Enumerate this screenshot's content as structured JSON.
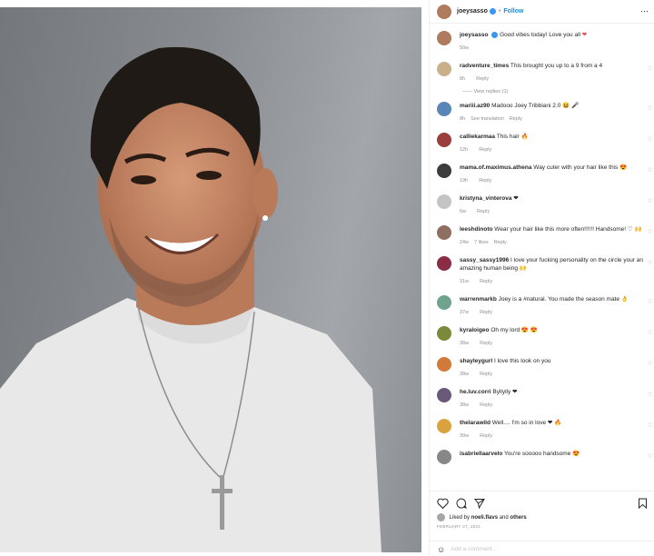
{
  "post": {
    "username": "joeysasso",
    "follow_label": "Follow",
    "caption": "Good vibes today! Love you all",
    "caption_emoji": "❤",
    "caption_time": "50w"
  },
  "comments": [
    {
      "user": "radventure_times",
      "text": "This brought you up to a 9 from a 4",
      "time": "8h",
      "reply": "Reply",
      "extra": "",
      "avatar": "#c9b08a",
      "replies": "View replies (1)"
    },
    {
      "user": "mariii.az90",
      "text": "Madooo Joey Tribbiani 2.0 😆 🎤",
      "time": "8h",
      "reply": "Reply",
      "extra": "See translation",
      "avatar": "#5a86b5",
      "replies": ""
    },
    {
      "user": "calliekarmaa",
      "text": "This hair 🔥",
      "time": "12h",
      "reply": "Reply",
      "extra": "",
      "avatar": "#9b3f3c",
      "replies": ""
    },
    {
      "user": "mama.of.maximus.athena",
      "text": "Way cuter with your hair like this 😍",
      "time": "19h",
      "reply": "Reply",
      "extra": "",
      "avatar": "#3c3c3c",
      "replies": ""
    },
    {
      "user": "kristyna_vinterova",
      "text": "❤",
      "time": "6w",
      "reply": "Reply",
      "extra": "",
      "avatar": "#c4c4c4",
      "replies": ""
    },
    {
      "user": "leeshdinoto",
      "text": "Wear your hair like this more often!!!!!! Handsome! ♡ 🙌",
      "time": "24w",
      "reply": "Reply",
      "extra": "7 likes",
      "avatar": "#8e6f62",
      "replies": ""
    },
    {
      "user": "sassy_sassy1996",
      "text": "I love your fucking personality on the circle your an amazing human being 🙌",
      "time": "31w",
      "reply": "Reply",
      "extra": "",
      "avatar": "#8a2c44",
      "replies": ""
    },
    {
      "user": "warrenmarkb",
      "text": "Joey is a #natural. You made the season mate 👌",
      "time": "37w",
      "reply": "Reply",
      "extra": "",
      "avatar": "#6fa38d",
      "replies": ""
    },
    {
      "user": "kyraloigeo",
      "text": "Oh my lord 😍 😍",
      "time": "38w",
      "reply": "Reply",
      "extra": "",
      "avatar": "#7a8a3a",
      "replies": ""
    },
    {
      "user": "shayleygurl",
      "text": "I love this look on you",
      "time": "38w",
      "reply": "Reply",
      "extra": "",
      "avatar": "#d27a3c",
      "replies": ""
    },
    {
      "user": "he.luv.corri",
      "text": "Byllylly ❤",
      "time": "38w",
      "reply": "Reply",
      "extra": "",
      "avatar": "#6a5a7a",
      "replies": ""
    },
    {
      "user": "thelarawild",
      "text": "Well.... I'm so in love ❤ 🔥",
      "time": "39w",
      "reply": "Reply",
      "extra": "",
      "avatar": "#d9a340",
      "replies": ""
    },
    {
      "user": "isabriellaarvelo",
      "text": "You're sooooo handsome 😍",
      "time": "",
      "reply": "",
      "extra": "",
      "avatar": "#888",
      "replies": ""
    }
  ],
  "footer": {
    "likes_text": "Liked by",
    "likes_user": "noeli.flavs",
    "likes_and": "and",
    "likes_others": "others",
    "date": "FEBRUARY 27, 2021",
    "add_comment_placeholder": "Add a comment…"
  },
  "colors": {
    "accent": "#0095f6",
    "verified": "#3897f0",
    "heart": "#ed4956"
  }
}
